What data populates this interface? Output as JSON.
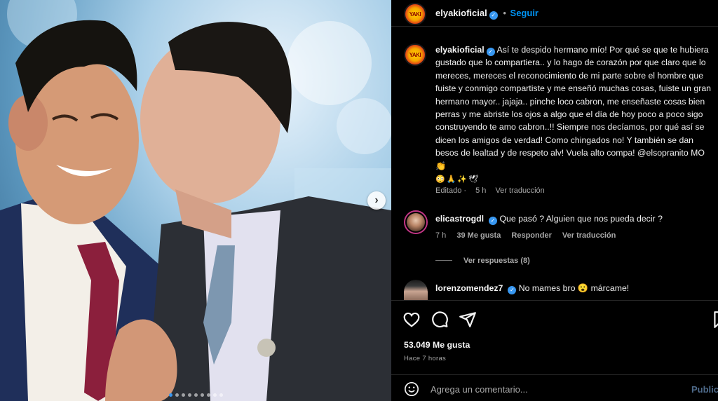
{
  "post": {
    "username": "elyakioficial",
    "follow_label": "Seguir",
    "separator": "•",
    "caption": "Así te despido hermano mío! Por qué se que te hubiera gustado que lo compartiera.. y lo hago de corazón por que claro que lo mereces, mereces el reconocimiento de mi parte sobre el hombre que fuiste y conmigo compartiste y me enseñó muchas cosas, fuiste un gran hermano mayor.. jajaja.. pinche loco cabron, me enseñaste cosas bien perras y me abriste los ojos a algo que el día de hoy poco a poco sigo construyendo te amo cabron..!! Siempre nos decíamos, por qué así se dicen los amigos de verdad! Como chingados no! Y también se dan besos de lealtad y de respeto alv! Vuela alto compa! @elsopranito MO 👏",
    "caption_emojis": "😳🙏✨🕊",
    "edited_label": "Editado",
    "edited_time": "5 h",
    "translate_label": "Ver traducción"
  },
  "comments": [
    {
      "username": "elicastrogdl",
      "text": "Que pasó ? Alguien que nos pueda decir ?",
      "time": "7 h",
      "likes": "39 Me gusta",
      "reply_label": "Responder",
      "translate_label": "Ver traducción",
      "view_replies": "Ver respuestas (8)"
    },
    {
      "username": "lorenzomendez7",
      "text": "No mames bro 😮 márcame!"
    }
  ],
  "actions": {
    "like_count": "53.049 Me gusta",
    "posted_ago": "Hace 7 horas"
  },
  "comment_box": {
    "placeholder": "Agrega un comentario...",
    "publish_label": "Publicar"
  },
  "carousel": {
    "slides": 9,
    "active_index": 0,
    "next_glyph": "›"
  },
  "colors": {
    "accent": "#0095f6",
    "verified": "#3897f0",
    "background": "#000000",
    "muted": "#a8a8a8"
  },
  "logo_text": "YAKI"
}
